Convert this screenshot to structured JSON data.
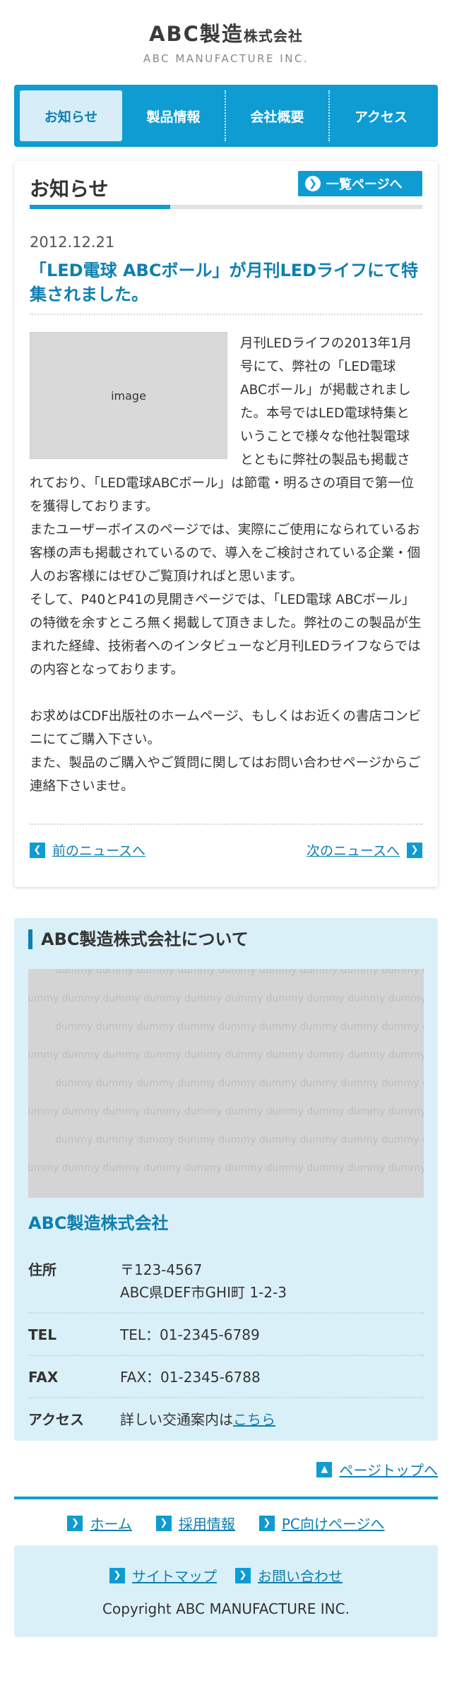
{
  "header": {
    "logo_main": "ABC製造",
    "logo_suffix": "株式会社",
    "logo_sub": "ABC MANUFACTURE INC."
  },
  "nav": {
    "items": [
      {
        "label": "お知らせ",
        "active": true
      },
      {
        "label": "製品情報"
      },
      {
        "label": "会社概要"
      },
      {
        "label": "アクセス"
      }
    ]
  },
  "news": {
    "section_title": "お知らせ",
    "more_label": "一覧ページへ",
    "article": {
      "date": "2012.12.21",
      "title": "「LED電球 ABCボール」が月刊LEDライフにて特集されました。",
      "image_label": "image",
      "paragraph1": "月刊LEDライフの2013年1月号にて、弊社の「LED電球ABCボール」が掲載されました。本号ではLED電球特集ということで様々な他社製電球とともに弊社の製品も掲載されており、「LED電球ABCボール」は節電・明るさの項目で第一位を獲得しております。",
      "paragraph2": "またユーザーボイスのページでは、実際にご使用になられているお客様の声も掲載されているので、導入をご検討されている企業・個人のお客様にはぜひご覧頂ければと思います。",
      "paragraph3": "そして、P40とP41の見開きページでは、「LED電球 ABCボール」の特徴を余すところ無く掲載して頂きました。弊社のこの製品が生まれた経緯、技術者へのインタビューなど月刊LEDライフならではの内容となっております。",
      "paragraph4": "お求めはCDF出版社のホームページ、もしくはお近くの書店コンビニにてご購入下さい。",
      "paragraph5": "また、製品のご購入やご質問に関してはお問い合わせページからご連絡下さいませ。"
    },
    "prev_label": "前のニュースへ",
    "next_label": "次のニュースへ"
  },
  "about": {
    "title": "ABC製造株式会社について",
    "map_placeholder": "dummy",
    "company_name": "ABC製造株式会社",
    "info": {
      "address_label": "住所",
      "address_postal": "〒123-4567",
      "address_line": "ABC県DEF市GHI町 1-2-3",
      "tel_label": "TEL",
      "tel_value": "TEL：01-2345-6789",
      "fax_label": "FAX",
      "fax_value": "FAX：01-2345-6788",
      "access_label": "アクセス",
      "access_text": "詳しい交通案内は",
      "access_link": "こちら"
    }
  },
  "pagetop_label": "ページトップへ",
  "footer": {
    "links": [
      "ホーム",
      "採用情報",
      "PC向けページへ"
    ],
    "box_links": [
      "サイトマップ",
      "お問い合わせ"
    ],
    "copyright": "Copyright ABC MANUFACTURE INC."
  },
  "colors": {
    "accent": "#0e9cd3",
    "link": "#0e7fb0",
    "light_bg": "#daf0f8"
  }
}
